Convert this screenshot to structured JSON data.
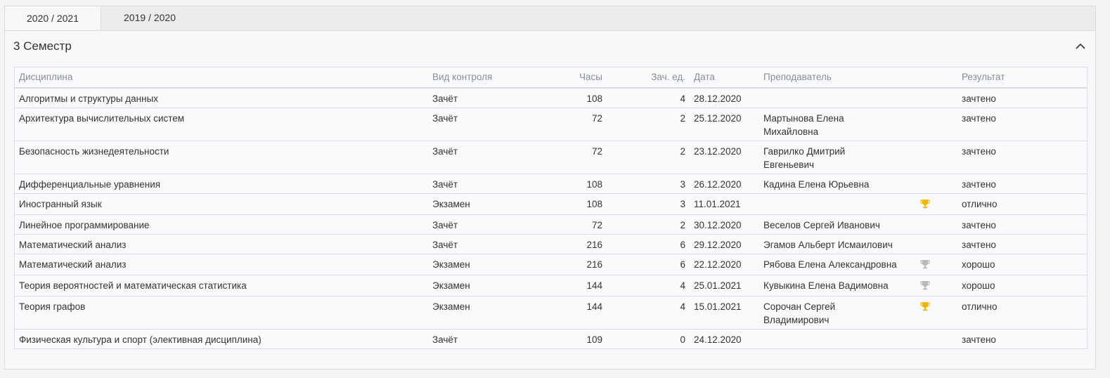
{
  "tabs": [
    {
      "label": "2020 / 2021",
      "active": true
    },
    {
      "label": "2019 / 2020",
      "active": false
    }
  ],
  "semester": {
    "title": "3 Семестр"
  },
  "table": {
    "headers": {
      "name": "Дисциплина",
      "type": "Вид контроля",
      "hours": "Часы",
      "credits": "Зач. ед.",
      "date": "Дата",
      "teacher": "Преподаватель",
      "result": "Результат"
    },
    "rows": [
      {
        "name": "Алгоритмы и структуры данных",
        "type": "Зачёт",
        "hours": "108",
        "credits": "4",
        "date": "28.12.2020",
        "teacher_1": "",
        "teacher_2": "",
        "trophy": "none",
        "result": "зачтено"
      },
      {
        "name": "Архитектура вычислительных систем",
        "type": "Зачёт",
        "hours": "72",
        "credits": "2",
        "date": "25.12.2020",
        "teacher_1": "Мартынова Елена",
        "teacher_2": "Михайловна",
        "trophy": "none",
        "result": "зачтено"
      },
      {
        "name": "Безопасность жизнедеятельности",
        "type": "Зачёт",
        "hours": "72",
        "credits": "2",
        "date": "23.12.2020",
        "teacher_1": "Гаврилко Дмитрий",
        "teacher_2": "Евгеньевич",
        "trophy": "none",
        "result": "зачтено"
      },
      {
        "name": "Дифференциальные уравнения",
        "type": "Зачёт",
        "hours": "108",
        "credits": "3",
        "date": "26.12.2020",
        "teacher_1": "Кадина Елена Юрьевна",
        "teacher_2": "",
        "trophy": "none",
        "result": "зачтено"
      },
      {
        "name": "Иностранный язык",
        "type": "Экзамен",
        "hours": "108",
        "credits": "3",
        "date": "11.01.2021",
        "teacher_1": "",
        "teacher_2": "",
        "trophy": "gold",
        "result": "отлично"
      },
      {
        "name": "Линейное программирование",
        "type": "Зачёт",
        "hours": "72",
        "credits": "2",
        "date": "30.12.2020",
        "teacher_1": "Веселов Сергей Иванович",
        "teacher_2": "",
        "trophy": "none",
        "result": "зачтено"
      },
      {
        "name": "Математический анализ",
        "type": "Зачёт",
        "hours": "216",
        "credits": "6",
        "date": "29.12.2020",
        "teacher_1": "Эгамов Альберт Исмаилович",
        "teacher_2": "",
        "trophy": "none",
        "result": "зачтено"
      },
      {
        "name": "Математический анализ",
        "type": "Экзамен",
        "hours": "216",
        "credits": "6",
        "date": "22.12.2020",
        "teacher_1": "Рябова Елена Александровна",
        "teacher_2": "",
        "trophy": "silver",
        "result": "хорошо"
      },
      {
        "name": "Теория вероятностей и математическая статистика",
        "type": "Экзамен",
        "hours": "144",
        "credits": "4",
        "date": "25.01.2021",
        "teacher_1": "Кувыкина Елена Вадимовна",
        "teacher_2": "",
        "trophy": "silver",
        "result": "хорошо"
      },
      {
        "name": "Теория графов",
        "type": "Экзамен",
        "hours": "144",
        "credits": "4",
        "date": "15.01.2021",
        "teacher_1": "Сорочан Сергей",
        "teacher_2": "Владимирович",
        "trophy": "gold",
        "result": "отлично"
      },
      {
        "name": "Физическая культура и спорт (элективная дисциплина)",
        "type": "Зачёт",
        "hours": "109",
        "credits": "0",
        "date": "24.12.2020",
        "teacher_1": "",
        "teacher_2": "",
        "trophy": "none",
        "result": "зачтено"
      }
    ]
  },
  "colors": {
    "trophy_gold": "#f2b705",
    "trophy_silver": "#b9b9b9"
  }
}
